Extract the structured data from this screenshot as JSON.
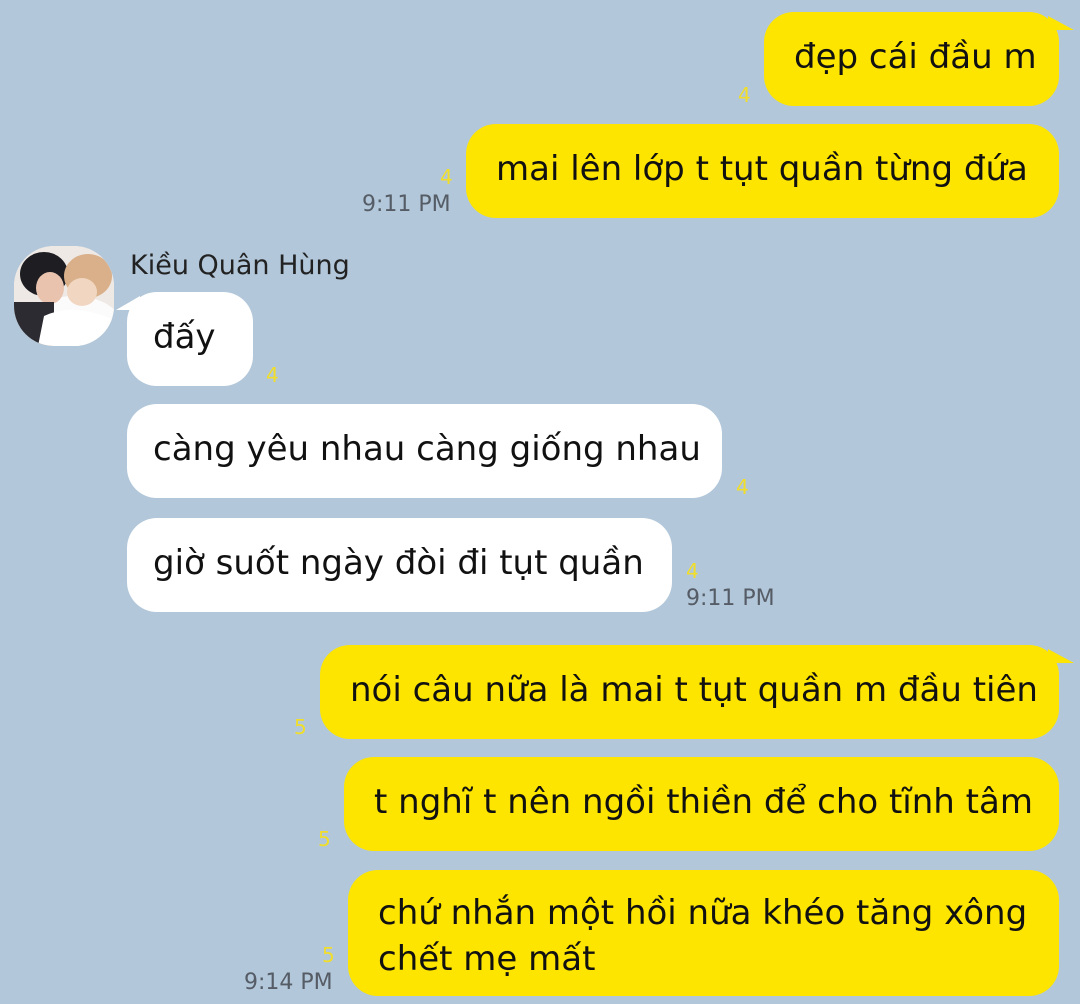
{
  "contact": {
    "name": "Kiều Quân Hùng",
    "avatar_icon": "profile-photo"
  },
  "colors": {
    "background": "#b2c7d9",
    "my_bubble": "#fee500",
    "their_bubble": "#ffffff",
    "unread_count": "#f1de2a"
  },
  "messages": [
    {
      "sender": "me",
      "text": "đẹp cái đầu m",
      "unread": "4",
      "time": ""
    },
    {
      "sender": "me",
      "text": "mai lên lớp t tụt quần từng đứa",
      "unread": "4",
      "time": "9:11 PM"
    },
    {
      "sender": "them",
      "text": "đấy",
      "unread": "4",
      "time": ""
    },
    {
      "sender": "them",
      "text": "càng yêu nhau càng giống nhau",
      "unread": "4",
      "time": ""
    },
    {
      "sender": "them",
      "text": "giờ suốt ngày đòi đi tụt quần",
      "unread": "4",
      "time": "9:11 PM"
    },
    {
      "sender": "me",
      "text": "nói câu nữa là mai t tụt quần m đầu tiên",
      "unread": "5",
      "time": ""
    },
    {
      "sender": "me",
      "text": "t nghĩ t nên ngồi thiền để cho tĩnh tâm",
      "unread": "5",
      "time": ""
    },
    {
      "sender": "me",
      "text_lines": [
        "chứ nhắn một hồi nữa khéo tăng xông",
        "chết mẹ mất"
      ],
      "unread": "5",
      "time": "9:14 PM"
    }
  ]
}
